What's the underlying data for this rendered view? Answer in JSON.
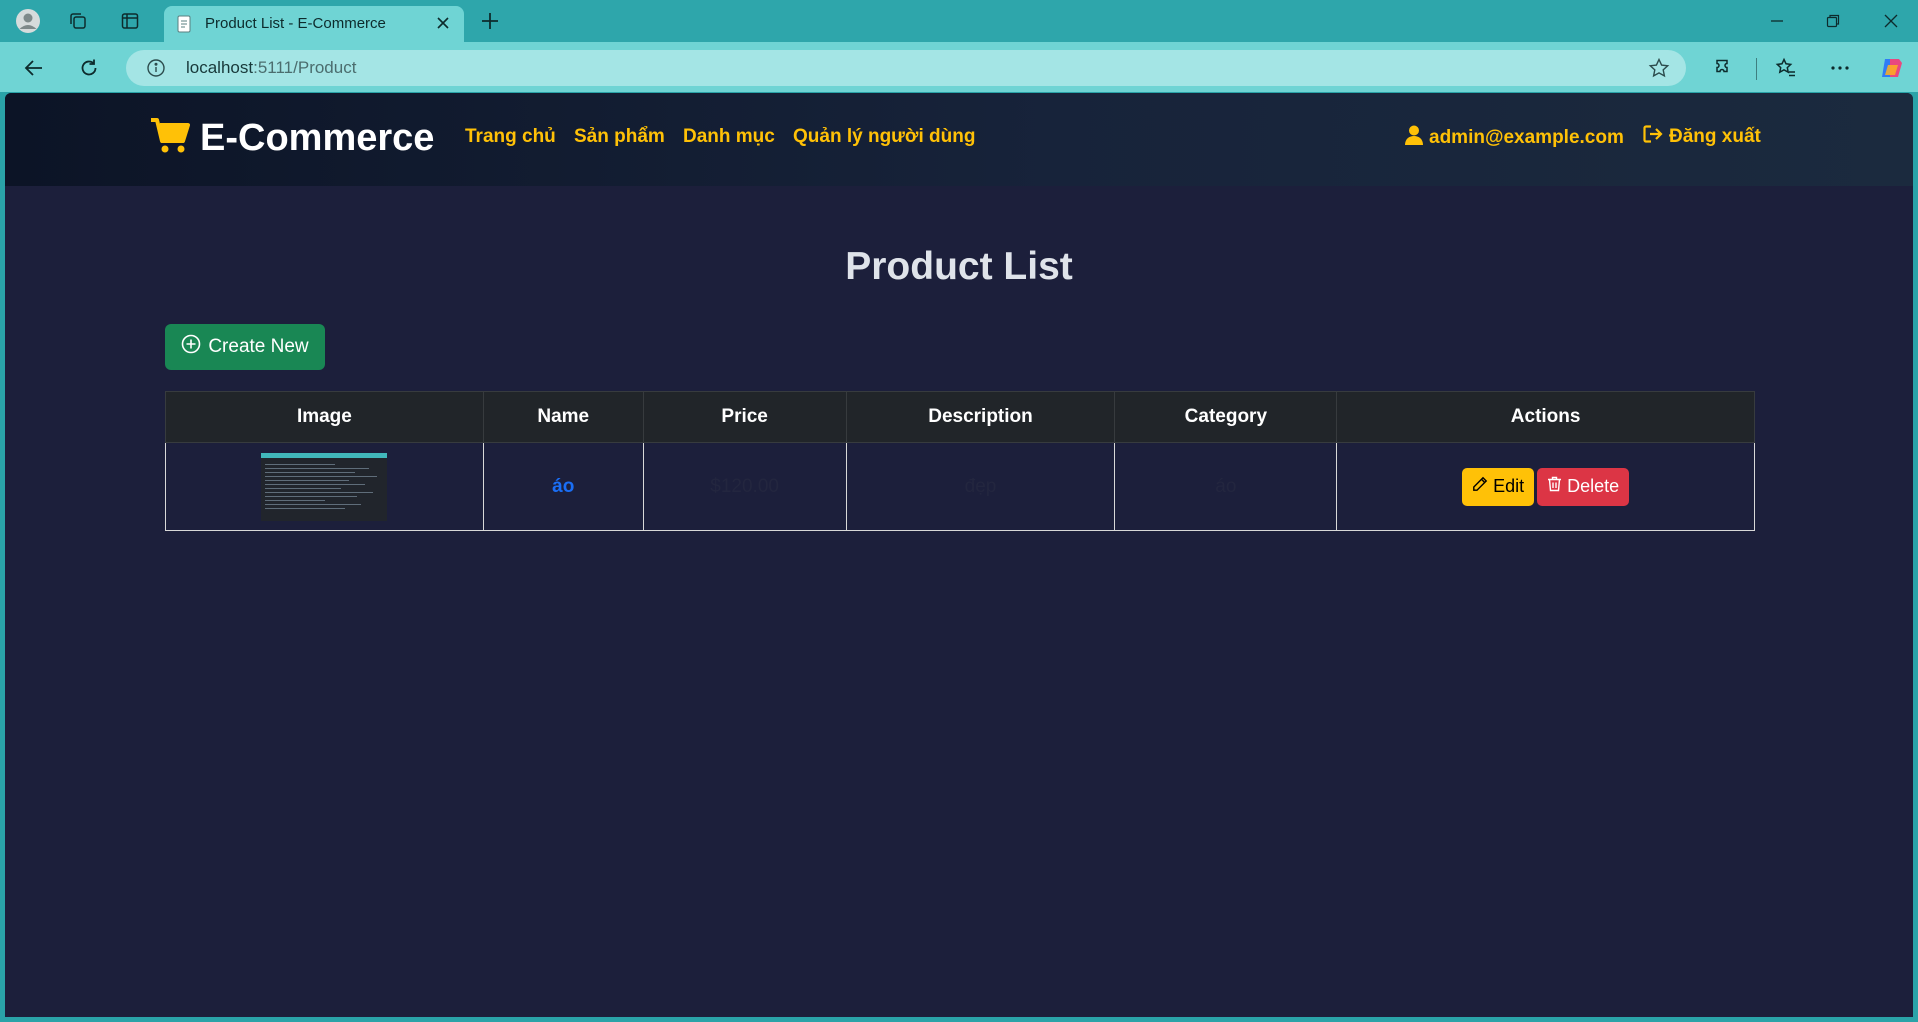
{
  "browser": {
    "tab_title": "Product List - E-Commerce",
    "url_host": "localhost",
    "url_rest": ":5111/Product"
  },
  "site": {
    "brand": "E-Commerce",
    "nav": {
      "home": "Trang chủ",
      "products": "Sản phẩm",
      "categories": "Danh mục",
      "users": "Quản lý người dùng"
    },
    "user_email": "admin@example.com",
    "logout": "Đăng xuất"
  },
  "page": {
    "title": "Product List",
    "create_label": "Create New"
  },
  "table": {
    "headers": {
      "image": "Image",
      "name": "Name",
      "price": "Price",
      "description": "Description",
      "category": "Category",
      "actions": "Actions"
    },
    "rows": [
      {
        "name": "áo",
        "price": "$120.00",
        "description": "đẹp",
        "category": "áo",
        "edit_label": "Edit",
        "delete_label": "Delete"
      }
    ]
  },
  "colors": {
    "accent": "#ffc107",
    "success": "#198754",
    "danger": "#dc3545",
    "link": "#1a6ef5",
    "page_bg": "#1c1f3b"
  },
  "icons": [
    "profile-icon",
    "collections-icon",
    "tab-actions-icon",
    "page-icon",
    "close-icon",
    "plus-icon",
    "minimize-icon",
    "restore-icon",
    "back-icon",
    "refresh-icon",
    "info-icon",
    "star-icon",
    "extensions-icon",
    "favorites-icon",
    "more-icon",
    "copilot-icon",
    "cart-icon",
    "user-icon",
    "logout-icon",
    "plus-circle-icon",
    "pencil-icon",
    "trash-icon"
  ]
}
